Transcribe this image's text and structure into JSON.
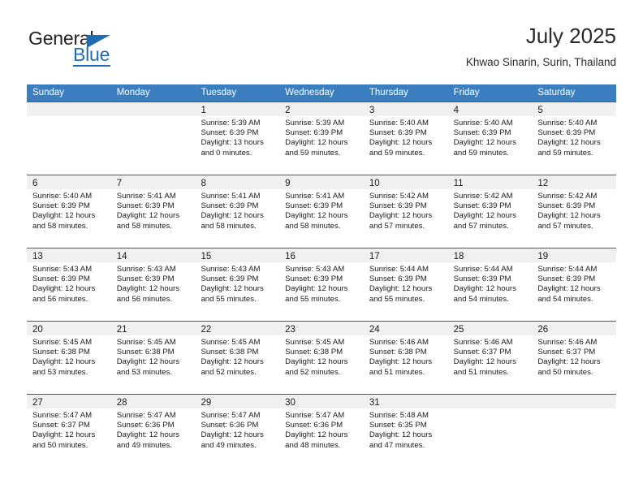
{
  "brand": {
    "name_part1": "General",
    "name_part2": "Blue",
    "triangle_icon": "triangle-icon",
    "accent_color": "#1f6cb5"
  },
  "header": {
    "title": "July 2025",
    "subtitle": "Khwao Sinarin, Surin, Thailand"
  },
  "calendar": {
    "header_bg": "#3b7ebf",
    "row_divider_color": "#1b65ab",
    "datebar_bg": "#f0f0f0",
    "weekdays": [
      "Sunday",
      "Monday",
      "Tuesday",
      "Wednesday",
      "Thursday",
      "Friday",
      "Saturday"
    ],
    "weeks": [
      [
        {
          "day": "",
          "sunrise": "",
          "sunset": "",
          "daylight_line1": "",
          "daylight_line2": ""
        },
        {
          "day": "",
          "sunrise": "",
          "sunset": "",
          "daylight_line1": "",
          "daylight_line2": ""
        },
        {
          "day": "1",
          "sunrise": "Sunrise: 5:39 AM",
          "sunset": "Sunset: 6:39 PM",
          "daylight_line1": "Daylight: 13 hours",
          "daylight_line2": "and 0 minutes."
        },
        {
          "day": "2",
          "sunrise": "Sunrise: 5:39 AM",
          "sunset": "Sunset: 6:39 PM",
          "daylight_line1": "Daylight: 12 hours",
          "daylight_line2": "and 59 minutes."
        },
        {
          "day": "3",
          "sunrise": "Sunrise: 5:40 AM",
          "sunset": "Sunset: 6:39 PM",
          "daylight_line1": "Daylight: 12 hours",
          "daylight_line2": "and 59 minutes."
        },
        {
          "day": "4",
          "sunrise": "Sunrise: 5:40 AM",
          "sunset": "Sunset: 6:39 PM",
          "daylight_line1": "Daylight: 12 hours",
          "daylight_line2": "and 59 minutes."
        },
        {
          "day": "5",
          "sunrise": "Sunrise: 5:40 AM",
          "sunset": "Sunset: 6:39 PM",
          "daylight_line1": "Daylight: 12 hours",
          "daylight_line2": "and 59 minutes."
        }
      ],
      [
        {
          "day": "6",
          "sunrise": "Sunrise: 5:40 AM",
          "sunset": "Sunset: 6:39 PM",
          "daylight_line1": "Daylight: 12 hours",
          "daylight_line2": "and 58 minutes."
        },
        {
          "day": "7",
          "sunrise": "Sunrise: 5:41 AM",
          "sunset": "Sunset: 6:39 PM",
          "daylight_line1": "Daylight: 12 hours",
          "daylight_line2": "and 58 minutes."
        },
        {
          "day": "8",
          "sunrise": "Sunrise: 5:41 AM",
          "sunset": "Sunset: 6:39 PM",
          "daylight_line1": "Daylight: 12 hours",
          "daylight_line2": "and 58 minutes."
        },
        {
          "day": "9",
          "sunrise": "Sunrise: 5:41 AM",
          "sunset": "Sunset: 6:39 PM",
          "daylight_line1": "Daylight: 12 hours",
          "daylight_line2": "and 58 minutes."
        },
        {
          "day": "10",
          "sunrise": "Sunrise: 5:42 AM",
          "sunset": "Sunset: 6:39 PM",
          "daylight_line1": "Daylight: 12 hours",
          "daylight_line2": "and 57 minutes."
        },
        {
          "day": "11",
          "sunrise": "Sunrise: 5:42 AM",
          "sunset": "Sunset: 6:39 PM",
          "daylight_line1": "Daylight: 12 hours",
          "daylight_line2": "and 57 minutes."
        },
        {
          "day": "12",
          "sunrise": "Sunrise: 5:42 AM",
          "sunset": "Sunset: 6:39 PM",
          "daylight_line1": "Daylight: 12 hours",
          "daylight_line2": "and 57 minutes."
        }
      ],
      [
        {
          "day": "13",
          "sunrise": "Sunrise: 5:43 AM",
          "sunset": "Sunset: 6:39 PM",
          "daylight_line1": "Daylight: 12 hours",
          "daylight_line2": "and 56 minutes."
        },
        {
          "day": "14",
          "sunrise": "Sunrise: 5:43 AM",
          "sunset": "Sunset: 6:39 PM",
          "daylight_line1": "Daylight: 12 hours",
          "daylight_line2": "and 56 minutes."
        },
        {
          "day": "15",
          "sunrise": "Sunrise: 5:43 AM",
          "sunset": "Sunset: 6:39 PM",
          "daylight_line1": "Daylight: 12 hours",
          "daylight_line2": "and 55 minutes."
        },
        {
          "day": "16",
          "sunrise": "Sunrise: 5:43 AM",
          "sunset": "Sunset: 6:39 PM",
          "daylight_line1": "Daylight: 12 hours",
          "daylight_line2": "and 55 minutes."
        },
        {
          "day": "17",
          "sunrise": "Sunrise: 5:44 AM",
          "sunset": "Sunset: 6:39 PM",
          "daylight_line1": "Daylight: 12 hours",
          "daylight_line2": "and 55 minutes."
        },
        {
          "day": "18",
          "sunrise": "Sunrise: 5:44 AM",
          "sunset": "Sunset: 6:39 PM",
          "daylight_line1": "Daylight: 12 hours",
          "daylight_line2": "and 54 minutes."
        },
        {
          "day": "19",
          "sunrise": "Sunrise: 5:44 AM",
          "sunset": "Sunset: 6:39 PM",
          "daylight_line1": "Daylight: 12 hours",
          "daylight_line2": "and 54 minutes."
        }
      ],
      [
        {
          "day": "20",
          "sunrise": "Sunrise: 5:45 AM",
          "sunset": "Sunset: 6:38 PM",
          "daylight_line1": "Daylight: 12 hours",
          "daylight_line2": "and 53 minutes."
        },
        {
          "day": "21",
          "sunrise": "Sunrise: 5:45 AM",
          "sunset": "Sunset: 6:38 PM",
          "daylight_line1": "Daylight: 12 hours",
          "daylight_line2": "and 53 minutes."
        },
        {
          "day": "22",
          "sunrise": "Sunrise: 5:45 AM",
          "sunset": "Sunset: 6:38 PM",
          "daylight_line1": "Daylight: 12 hours",
          "daylight_line2": "and 52 minutes."
        },
        {
          "day": "23",
          "sunrise": "Sunrise: 5:45 AM",
          "sunset": "Sunset: 6:38 PM",
          "daylight_line1": "Daylight: 12 hours",
          "daylight_line2": "and 52 minutes."
        },
        {
          "day": "24",
          "sunrise": "Sunrise: 5:46 AM",
          "sunset": "Sunset: 6:38 PM",
          "daylight_line1": "Daylight: 12 hours",
          "daylight_line2": "and 51 minutes."
        },
        {
          "day": "25",
          "sunrise": "Sunrise: 5:46 AM",
          "sunset": "Sunset: 6:37 PM",
          "daylight_line1": "Daylight: 12 hours",
          "daylight_line2": "and 51 minutes."
        },
        {
          "day": "26",
          "sunrise": "Sunrise: 5:46 AM",
          "sunset": "Sunset: 6:37 PM",
          "daylight_line1": "Daylight: 12 hours",
          "daylight_line2": "and 50 minutes."
        }
      ],
      [
        {
          "day": "27",
          "sunrise": "Sunrise: 5:47 AM",
          "sunset": "Sunset: 6:37 PM",
          "daylight_line1": "Daylight: 12 hours",
          "daylight_line2": "and 50 minutes."
        },
        {
          "day": "28",
          "sunrise": "Sunrise: 5:47 AM",
          "sunset": "Sunset: 6:36 PM",
          "daylight_line1": "Daylight: 12 hours",
          "daylight_line2": "and 49 minutes."
        },
        {
          "day": "29",
          "sunrise": "Sunrise: 5:47 AM",
          "sunset": "Sunset: 6:36 PM",
          "daylight_line1": "Daylight: 12 hours",
          "daylight_line2": "and 49 minutes."
        },
        {
          "day": "30",
          "sunrise": "Sunrise: 5:47 AM",
          "sunset": "Sunset: 6:36 PM",
          "daylight_line1": "Daylight: 12 hours",
          "daylight_line2": "and 48 minutes."
        },
        {
          "day": "31",
          "sunrise": "Sunrise: 5:48 AM",
          "sunset": "Sunset: 6:35 PM",
          "daylight_line1": "Daylight: 12 hours",
          "daylight_line2": "and 47 minutes."
        },
        {
          "day": "",
          "sunrise": "",
          "sunset": "",
          "daylight_line1": "",
          "daylight_line2": ""
        },
        {
          "day": "",
          "sunrise": "",
          "sunset": "",
          "daylight_line1": "",
          "daylight_line2": ""
        }
      ]
    ]
  }
}
